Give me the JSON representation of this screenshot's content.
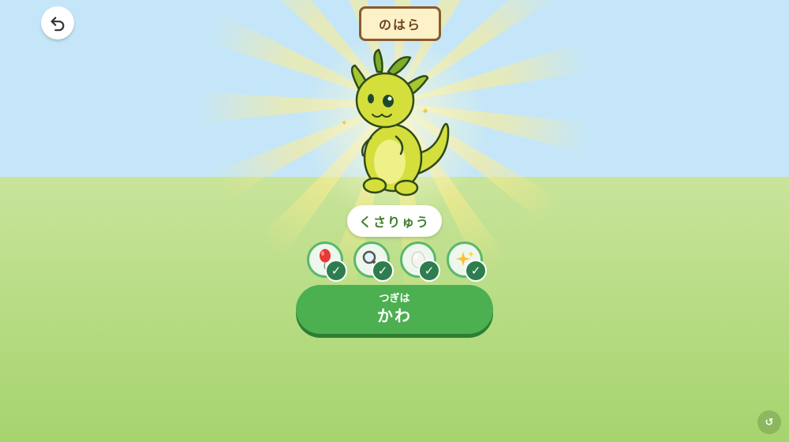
{
  "header": {
    "back_icon": "back-arrow-icon",
    "location_title": "のはら"
  },
  "creature": {
    "name": "くさりゅう",
    "image": "grass-dragon"
  },
  "items": [
    {
      "name": "balloon",
      "icon": "balloon-icon",
      "collected": true,
      "check": "✓"
    },
    {
      "name": "magnifier",
      "icon": "magnifier-icon",
      "collected": true,
      "check": "✓"
    },
    {
      "name": "egg",
      "icon": "egg-icon",
      "collected": true,
      "check": "✓"
    },
    {
      "name": "sparkles",
      "icon": "sparkles-icon",
      "collected": true,
      "check": "✓"
    }
  ],
  "next_button": {
    "sub_label": "つぎは",
    "main_label": "かわ"
  },
  "reset_button": {
    "label": "↺"
  },
  "colors": {
    "sky": "#c5e6f8",
    "grass": "#b5dc82",
    "button_green": "#4caf50",
    "check_green": "#2e7d4f",
    "title_border": "#8a5a2b"
  }
}
